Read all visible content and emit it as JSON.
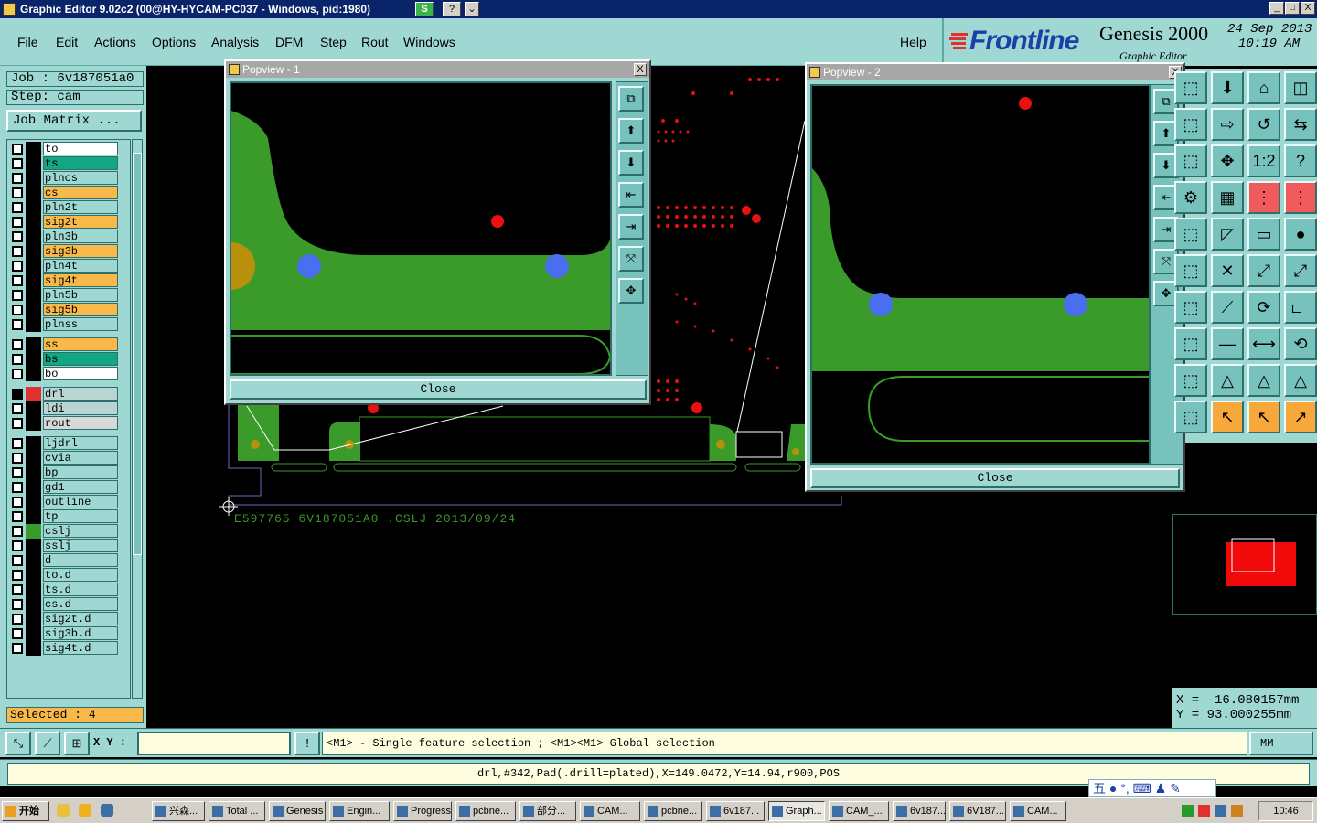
{
  "window": {
    "title": "Graphic Editor 9.02c2 (00@HY-HYCAM-PC037 - Windows, pid:1980)",
    "title_btn_1": "S",
    "title_btn_2": "?",
    "title_btn_3": "⌄",
    "minimize": "_",
    "maximize": "□",
    "close": "X"
  },
  "menu": {
    "items": [
      "File",
      "Edit",
      "Actions",
      "Options",
      "Analysis",
      "DFM",
      "Step",
      "Rout",
      "Windows"
    ],
    "help": "Help"
  },
  "logo": {
    "brand": "Frontline",
    "product": "Genesis 2000",
    "subtitle": "Graphic Editor",
    "date": "24 Sep 2013",
    "time": "10:19 AM"
  },
  "job": {
    "job_label": "Job : 6v187051a0",
    "step_label": "Step: cam",
    "matrix_button": "Job Matrix ..."
  },
  "layers": [
    {
      "name": "to",
      "color": "#ffffff",
      "swatch": "#000000"
    },
    {
      "name": "ts",
      "color": "#12a683",
      "swatch": "#000000"
    },
    {
      "name": "plncs",
      "color": "#9fd7d3",
      "swatch": "#000000"
    },
    {
      "name": "cs",
      "color": "#f9b94a",
      "swatch": "#000000"
    },
    {
      "name": "pln2t",
      "color": "#9fd7d3",
      "swatch": "#000000"
    },
    {
      "name": "sig2t",
      "color": "#f9b94a",
      "swatch": "#000000"
    },
    {
      "name": "pln3b",
      "color": "#9fd7d3",
      "swatch": "#000000"
    },
    {
      "name": "sig3b",
      "color": "#f9b94a",
      "swatch": "#000000"
    },
    {
      "name": "pln4t",
      "color": "#9fd7d3",
      "swatch": "#000000"
    },
    {
      "name": "sig4t",
      "color": "#f9b94a",
      "swatch": "#000000"
    },
    {
      "name": "pln5b",
      "color": "#9fd7d3",
      "swatch": "#000000"
    },
    {
      "name": "sig5b",
      "color": "#f9b94a",
      "swatch": "#000000"
    },
    {
      "name": "plnss",
      "color": "#9fd7d3",
      "swatch": "#000000"
    },
    {
      "name": "ss",
      "color": "#f9b94a",
      "swatch": "#000000"
    },
    {
      "name": "bs",
      "color": "#12a683",
      "swatch": "#000000"
    },
    {
      "name": "bo",
      "color": "#ffffff",
      "swatch": "#000000"
    },
    {
      "name": "drl",
      "color": "#b9d5d3",
      "swatch": "#e03030"
    },
    {
      "name": "ldi",
      "color": "#b9d5d3",
      "swatch": "#000000"
    },
    {
      "name": "rout",
      "color": "#d8d8d8",
      "swatch": "#000000"
    },
    {
      "name": "ljdrl",
      "color": "#9fd7d3",
      "swatch": "#000000"
    },
    {
      "name": "cvia",
      "color": "#9fd7d3",
      "swatch": "#000000"
    },
    {
      "name": "bp",
      "color": "#9fd7d3",
      "swatch": "#000000"
    },
    {
      "name": "gd1",
      "color": "#9fd7d3",
      "swatch": "#000000"
    },
    {
      "name": "outline",
      "color": "#9fd7d3",
      "swatch": "#000000"
    },
    {
      "name": "tp",
      "color": "#9fd7d3",
      "swatch": "#000000"
    },
    {
      "name": "cslj",
      "color": "#9fd7d3",
      "swatch": "#3a9a2a"
    },
    {
      "name": "sslj",
      "color": "#9fd7d3",
      "swatch": "#000000"
    },
    {
      "name": "d",
      "color": "#9fd7d3",
      "swatch": "#000000"
    },
    {
      "name": "to.d",
      "color": "#9fd7d3",
      "swatch": "#000000"
    },
    {
      "name": "ts.d",
      "color": "#9fd7d3",
      "swatch": "#000000"
    },
    {
      "name": "cs.d",
      "color": "#9fd7d3",
      "swatch": "#000000"
    },
    {
      "name": "sig2t.d",
      "color": "#9fd7d3",
      "swatch": "#000000"
    },
    {
      "name": "sig3b.d",
      "color": "#9fd7d3",
      "swatch": "#000000"
    },
    {
      "name": "sig4t.d",
      "color": "#9fd7d3",
      "swatch": "#000000"
    }
  ],
  "selected": "Selected : 4",
  "canvas": {
    "board_text": "E597765 6V187051A0 .CSLJ 2013/09/24"
  },
  "popview1": {
    "title": "Popview - 1",
    "close_x": "X",
    "close_button": "Close"
  },
  "popview2": {
    "title": "Popview - 2",
    "close_x": "X",
    "close_button": "Close"
  },
  "coords": {
    "x": "X = -16.080157mm",
    "y": "Y = 93.000255mm"
  },
  "command": {
    "xy_label": "X Y :",
    "xy_value": "",
    "bang": "!",
    "prompt": "<M1> - Single feature selection ; <M1><M1> Global selection",
    "units": "MM"
  },
  "status": "drl,#342,Pad(.drill=plated),X=149.0472,Y=14.94,r900,POS",
  "taskbar": {
    "start": "开始",
    "tasks": [
      "兴森...",
      "Total ...",
      "Genesis",
      "Engin...",
      "Progress",
      "pcbne...",
      "部分...",
      "CAM...",
      "pcbne...",
      "6v187...",
      "Graph...",
      "CAM_...",
      "6v187...",
      "6V187...",
      "CAM..."
    ],
    "clock": "10:46",
    "ime": "五"
  },
  "colors": {
    "panel": "#9fd7d3",
    "copper_green": "#3a9a2a",
    "drill_blue": "#4a6ef0",
    "drill_red": "#e81010"
  }
}
